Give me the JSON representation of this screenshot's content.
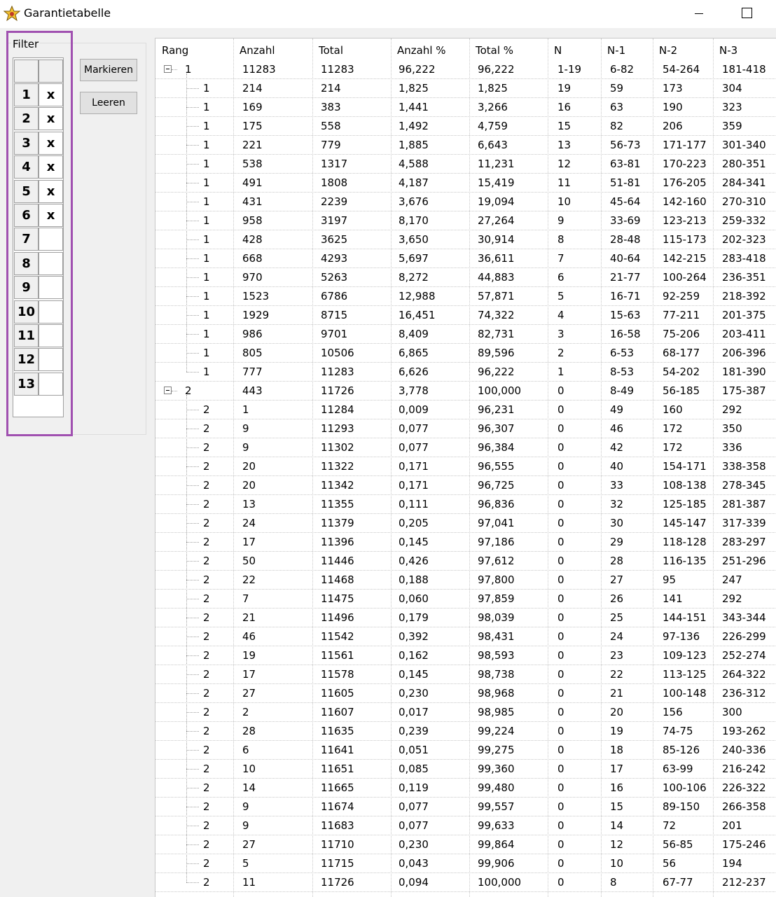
{
  "window": {
    "title": "Garantietabelle"
  },
  "filter": {
    "label": "Filter",
    "rows": [
      {
        "num": "1",
        "mark": "x"
      },
      {
        "num": "2",
        "mark": "x"
      },
      {
        "num": "3",
        "mark": "x"
      },
      {
        "num": "4",
        "mark": "x"
      },
      {
        "num": "5",
        "mark": "x"
      },
      {
        "num": "6",
        "mark": "x"
      },
      {
        "num": "7",
        "mark": ""
      },
      {
        "num": "8",
        "mark": ""
      },
      {
        "num": "9",
        "mark": ""
      },
      {
        "num": "10",
        "mark": ""
      },
      {
        "num": "11",
        "mark": ""
      },
      {
        "num": "12",
        "mark": ""
      },
      {
        "num": "13",
        "mark": ""
      }
    ]
  },
  "buttons": {
    "mark_label": "Markieren",
    "clear_label": "Leeren"
  },
  "grid": {
    "columns": [
      "Rang",
      "Anzahl",
      "Total",
      "Anzahl %",
      "Total %",
      "N",
      "N-1",
      "N-2",
      "N-3"
    ],
    "rows": [
      [
        "1",
        "11283",
        "11283",
        "96,222",
        "96,222",
        "1-19",
        "6-82",
        "54-264",
        "181-418"
      ],
      [
        "1",
        "214",
        "214",
        "1,825",
        "1,825",
        "19",
        "59",
        "173",
        "304"
      ],
      [
        "1",
        "169",
        "383",
        "1,441",
        "3,266",
        "16",
        "63",
        "190",
        "323"
      ],
      [
        "1",
        "175",
        "558",
        "1,492",
        "4,759",
        "15",
        "82",
        "206",
        "359"
      ],
      [
        "1",
        "221",
        "779",
        "1,885",
        "6,643",
        "13",
        "56-73",
        "171-177",
        "301-340"
      ],
      [
        "1",
        "538",
        "1317",
        "4,588",
        "11,231",
        "12",
        "63-81",
        "170-223",
        "280-351"
      ],
      [
        "1",
        "491",
        "1808",
        "4,187",
        "15,419",
        "11",
        "51-81",
        "176-205",
        "284-341"
      ],
      [
        "1",
        "431",
        "2239",
        "3,676",
        "19,094",
        "10",
        "45-64",
        "142-160",
        "270-310"
      ],
      [
        "1",
        "958",
        "3197",
        "8,170",
        "27,264",
        "9",
        "33-69",
        "123-213",
        "259-332"
      ],
      [
        "1",
        "428",
        "3625",
        "3,650",
        "30,914",
        "8",
        "28-48",
        "115-173",
        "202-323"
      ],
      [
        "1",
        "668",
        "4293",
        "5,697",
        "36,611",
        "7",
        "40-64",
        "142-215",
        "283-418"
      ],
      [
        "1",
        "970",
        "5263",
        "8,272",
        "44,883",
        "6",
        "21-77",
        "100-264",
        "236-351"
      ],
      [
        "1",
        "1523",
        "6786",
        "12,988",
        "57,871",
        "5",
        "16-71",
        "92-259",
        "218-392"
      ],
      [
        "1",
        "1929",
        "8715",
        "16,451",
        "74,322",
        "4",
        "15-63",
        "77-211",
        "201-375"
      ],
      [
        "1",
        "986",
        "9701",
        "8,409",
        "82,731",
        "3",
        "16-58",
        "75-206",
        "203-411"
      ],
      [
        "1",
        "805",
        "10506",
        "6,865",
        "89,596",
        "2",
        "6-53",
        "68-177",
        "206-396"
      ],
      [
        "1",
        "777",
        "11283",
        "6,626",
        "96,222",
        "1",
        "8-53",
        "54-202",
        "181-390"
      ],
      [
        "2",
        "443",
        "11726",
        "3,778",
        "100,000",
        "0",
        "8-49",
        "56-185",
        "175-387"
      ],
      [
        "2",
        "1",
        "11284",
        "0,009",
        "96,231",
        "0",
        "49",
        "160",
        "292"
      ],
      [
        "2",
        "9",
        "11293",
        "0,077",
        "96,307",
        "0",
        "46",
        "172",
        "350"
      ],
      [
        "2",
        "9",
        "11302",
        "0,077",
        "96,384",
        "0",
        "42",
        "172",
        "336"
      ],
      [
        "2",
        "20",
        "11322",
        "0,171",
        "96,555",
        "0",
        "40",
        "154-171",
        "338-358"
      ],
      [
        "2",
        "20",
        "11342",
        "0,171",
        "96,725",
        "0",
        "33",
        "108-138",
        "278-345"
      ],
      [
        "2",
        "13",
        "11355",
        "0,111",
        "96,836",
        "0",
        "32",
        "125-185",
        "281-387"
      ],
      [
        "2",
        "24",
        "11379",
        "0,205",
        "97,041",
        "0",
        "30",
        "145-147",
        "317-339"
      ],
      [
        "2",
        "17",
        "11396",
        "0,145",
        "97,186",
        "0",
        "29",
        "118-128",
        "283-297"
      ],
      [
        "2",
        "50",
        "11446",
        "0,426",
        "97,612",
        "0",
        "28",
        "116-135",
        "251-296"
      ],
      [
        "2",
        "22",
        "11468",
        "0,188",
        "97,800",
        "0",
        "27",
        "95",
        "247"
      ],
      [
        "2",
        "7",
        "11475",
        "0,060",
        "97,859",
        "0",
        "26",
        "141",
        "292"
      ],
      [
        "2",
        "21",
        "11496",
        "0,179",
        "98,039",
        "0",
        "25",
        "144-151",
        "343-344"
      ],
      [
        "2",
        "46",
        "11542",
        "0,392",
        "98,431",
        "0",
        "24",
        "97-136",
        "226-299"
      ],
      [
        "2",
        "19",
        "11561",
        "0,162",
        "98,593",
        "0",
        "23",
        "109-123",
        "252-274"
      ],
      [
        "2",
        "17",
        "11578",
        "0,145",
        "98,738",
        "0",
        "22",
        "113-125",
        "264-322"
      ],
      [
        "2",
        "27",
        "11605",
        "0,230",
        "98,968",
        "0",
        "21",
        "100-148",
        "236-312"
      ],
      [
        "2",
        "2",
        "11607",
        "0,017",
        "98,985",
        "0",
        "20",
        "156",
        "300"
      ],
      [
        "2",
        "28",
        "11635",
        "0,239",
        "99,224",
        "0",
        "19",
        "74-75",
        "193-262"
      ],
      [
        "2",
        "6",
        "11641",
        "0,051",
        "99,275",
        "0",
        "18",
        "85-126",
        "240-336"
      ],
      [
        "2",
        "10",
        "11651",
        "0,085",
        "99,360",
        "0",
        "17",
        "63-99",
        "216-242"
      ],
      [
        "2",
        "14",
        "11665",
        "0,119",
        "99,480",
        "0",
        "16",
        "100-106",
        "226-322"
      ],
      [
        "2",
        "9",
        "11674",
        "0,077",
        "99,557",
        "0",
        "15",
        "89-150",
        "266-358"
      ],
      [
        "2",
        "9",
        "11683",
        "0,077",
        "99,633",
        "0",
        "14",
        "72",
        "201"
      ],
      [
        "2",
        "27",
        "11710",
        "0,230",
        "99,864",
        "0",
        "12",
        "56-85",
        "175-246"
      ],
      [
        "2",
        "5",
        "11715",
        "0,043",
        "99,906",
        "0",
        "10",
        "56",
        "194"
      ],
      [
        "2",
        "11",
        "11726",
        "0,094",
        "100,000",
        "0",
        "8",
        "67-77",
        "212-237"
      ]
    ],
    "parent_rows": [
      0,
      17
    ]
  },
  "colors": {
    "highlight": "#a050b0"
  }
}
